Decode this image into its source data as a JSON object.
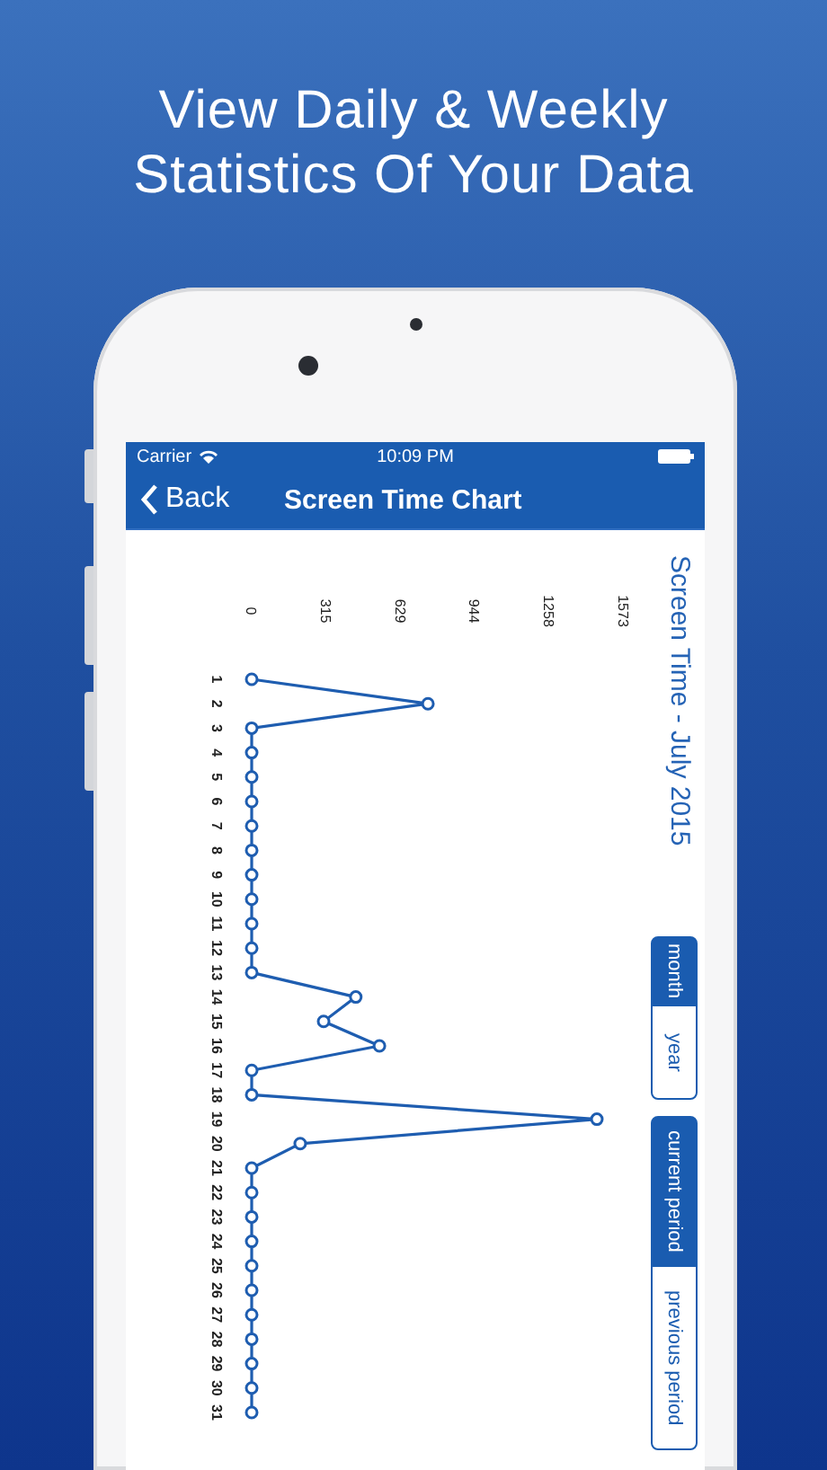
{
  "headline": "View Daily & Weekly Statistics Of Your Data",
  "status_bar": {
    "carrier": "Carrier",
    "time": "10:09 PM"
  },
  "nav_bar": {
    "back": "Back",
    "title": "Screen Time Chart"
  },
  "chart_data": {
    "type": "line",
    "title": "Screen Time - July 2015",
    "categories": [
      "1",
      "2",
      "3",
      "4",
      "5",
      "6",
      "7",
      "8",
      "9",
      "10",
      "11",
      "12",
      "13",
      "14",
      "15",
      "16",
      "17",
      "18",
      "19",
      "20",
      "21",
      "22",
      "23",
      "24",
      "25",
      "26",
      "27",
      "28",
      "29",
      "30",
      "31"
    ],
    "orientation": "horizontal",
    "xticks": [
      0,
      315,
      629,
      944,
      1258,
      1573
    ],
    "xlim": [
      0,
      1573
    ],
    "series": [
      {
        "color": "#1e5db0",
        "marker": "circle",
        "values": [
          0,
          745,
          0,
          0,
          0,
          0,
          0,
          0,
          0,
          0,
          0,
          0,
          0,
          440,
          304,
          540,
          0,
          0,
          1459,
          205,
          0,
          0,
          0,
          0,
          0,
          0,
          0,
          0,
          0,
          0,
          0
        ]
      }
    ]
  },
  "range_toggle": [
    {
      "label": "month",
      "selected": true
    },
    {
      "label": "year",
      "selected": false
    }
  ],
  "period_toggle": [
    {
      "label": "current period",
      "selected": true
    },
    {
      "label": "previous period",
      "selected": false
    }
  ]
}
